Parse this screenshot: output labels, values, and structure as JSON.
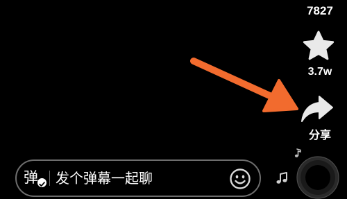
{
  "right_rail": {
    "like_count": "7827",
    "favorite_icon": "star-icon",
    "favorite_count": "3.7w",
    "share_icon": "share-arrow-icon",
    "share_label": "分享"
  },
  "danmu_bar": {
    "toggle_char": "弹",
    "toggle_icon": "check-badge-icon",
    "placeholder": "发个弹幕一起聊",
    "emoji_icon": "smiley-face-icon"
  },
  "music": {
    "note_icon": "music-note-icon",
    "disc_icon": "music-disc-icon"
  },
  "annotation": {
    "arrow_color": "#f26b2e"
  },
  "colors": {
    "background": "#000000",
    "text": "#ffffff",
    "icon": "#e9e9e9",
    "bar_border": "#6d6d6d"
  }
}
